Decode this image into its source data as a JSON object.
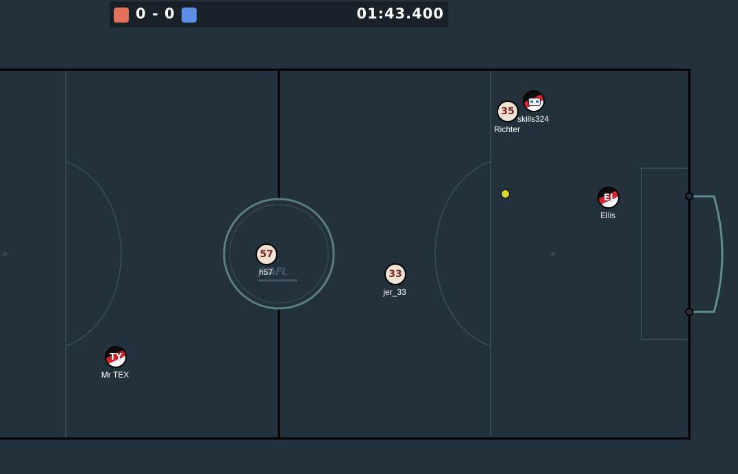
{
  "hud": {
    "red_score": "0",
    "separator": "-",
    "blue_score": "0",
    "timer": "01:43.400",
    "red_color": "#e5705a",
    "blue_color": "#5b8ee6"
  },
  "pitch": {
    "background": "#22313b",
    "line_color": "#000000",
    "marking_color": "#344956",
    "goal_color": "#5d8f92",
    "center_logo_text": "JVAFL"
  },
  "players": [
    {
      "id": "richter",
      "name": "Richter",
      "avatar": "35",
      "style": "plain"
    },
    {
      "id": "skills324",
      "name": "skills324",
      "avatar": "",
      "style": "robot"
    },
    {
      "id": "ellis",
      "name": "Ellis",
      "avatar": "EI",
      "style": "red-flag"
    },
    {
      "id": "h57",
      "name": "h57",
      "avatar": "57",
      "style": "plain"
    },
    {
      "id": "jer33",
      "name": "jer_33",
      "avatar": "33",
      "style": "plain"
    },
    {
      "id": "mrtex",
      "name": "Mr TEX",
      "avatar": "TY",
      "style": "red-flag"
    }
  ],
  "ball": {
    "color": "#d9d62a"
  }
}
